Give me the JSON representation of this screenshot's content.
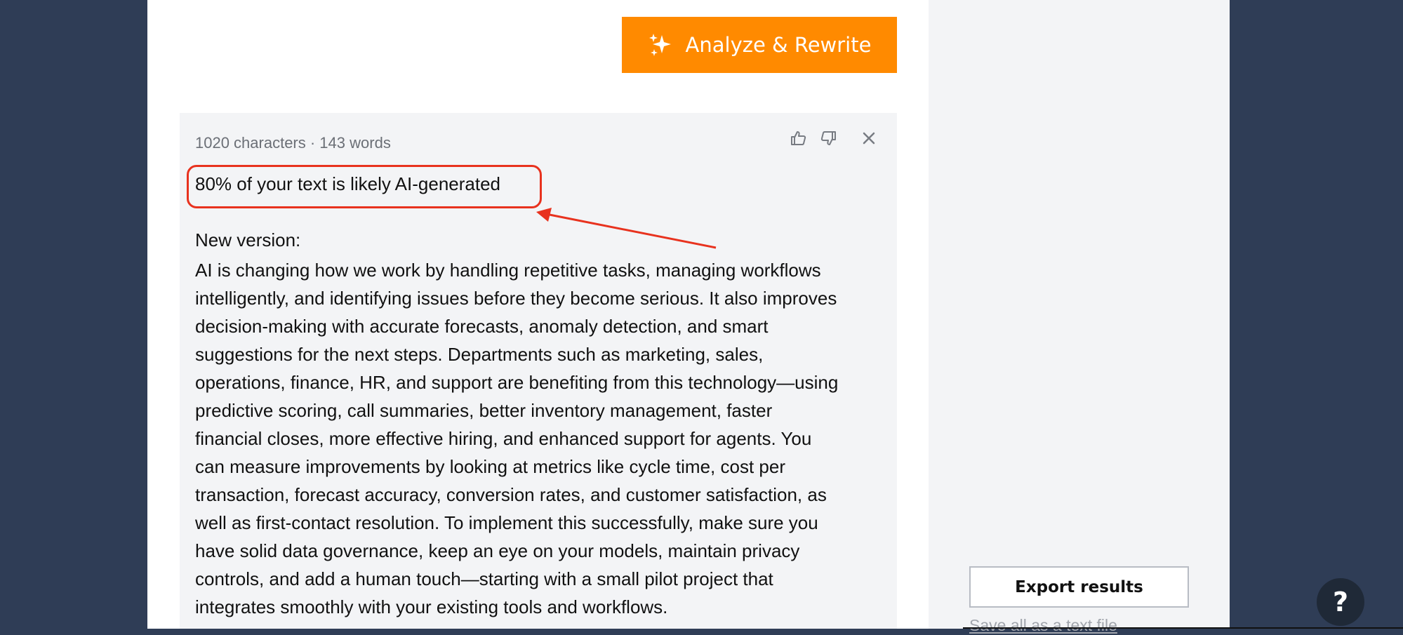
{
  "toolbar": {
    "analyze_label": "Analyze & Rewrite",
    "analyze_icon": "sparkles-icon"
  },
  "result": {
    "counts": "1020 characters · 143 words",
    "ai_score_text": "80% of your text is likely AI-generated",
    "new_version_label": "New version:",
    "rewritten_text": "AI is changing how we work by handling repetitive tasks, managing workflows\nintelligently, and identifying issues before they become serious. It also improves\ndecision-making with accurate forecasts, anomaly detection, and smart\nsuggestions for the next steps. Departments such as marketing, sales,\noperations, finance, HR, and support are benefiting from this technology—using\npredictive scoring, call summaries, better inventory management, faster\nfinancial closes, more effective hiring, and enhanced support for agents. You\ncan measure improvements by looking at metrics like cycle time, cost per\ntransaction, forecast accuracy, conversion rates, and customer satisfaction, as\nwell as first-contact resolution. To implement this successfully, make sure you\nhave solid data governance, keep an eye on your models, maintain privacy\ncontrols, and add a human touch—starting with a small pilot project that\nintegrates smoothly with your existing tools and workflows.",
    "actions": [
      "thumbs-up-icon",
      "thumbs-down-icon",
      "close-icon"
    ]
  },
  "sidebar": {
    "export_label": "Export results",
    "export_hint": "Save all as a text file"
  },
  "help": {
    "label": "?"
  },
  "colors": {
    "background": "#2f3d56",
    "accent": "#ff8a00",
    "annotation": "#e8321e",
    "card": "#f3f4f6"
  }
}
